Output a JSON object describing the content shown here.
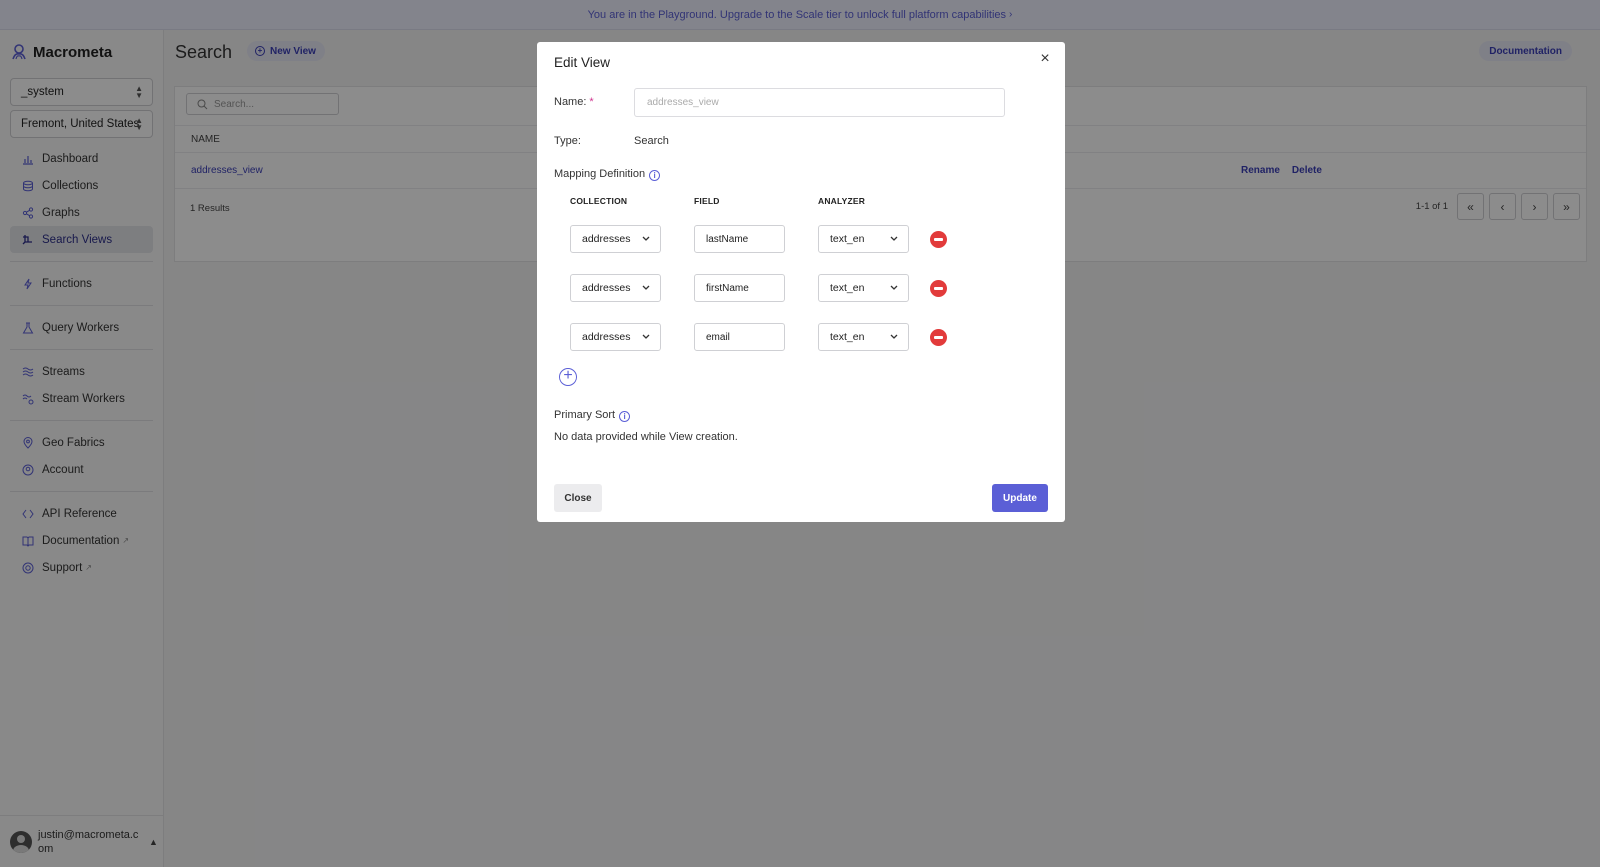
{
  "banner": {
    "text": "You are in the Playground. Upgrade to the Scale tier to unlock full platform capabilities"
  },
  "sidebar": {
    "brand": "Macrometa",
    "database_select": "_system",
    "region_select": "Fremont, United States",
    "items": [
      {
        "label": "Dashboard",
        "icon": "bar-chart-icon"
      },
      {
        "label": "Collections",
        "icon": "database-icon"
      },
      {
        "label": "Graphs",
        "icon": "graph-icon"
      },
      {
        "label": "Search Views",
        "icon": "search-views-icon",
        "active": true
      },
      {
        "label": "Functions",
        "icon": "function-icon"
      },
      {
        "label": "Query Workers",
        "icon": "query-workers-icon"
      },
      {
        "label": "Streams",
        "icon": "streams-icon"
      },
      {
        "label": "Stream Workers",
        "icon": "stream-workers-icon"
      },
      {
        "label": "Geo Fabrics",
        "icon": "geo-pin-icon"
      },
      {
        "label": "Account",
        "icon": "account-icon"
      },
      {
        "label": "API Reference",
        "icon": "code-icon"
      },
      {
        "label": "Documentation",
        "icon": "book-icon"
      },
      {
        "label": "Support",
        "icon": "lifebuoy-icon"
      }
    ],
    "user": "justin@macrometa.com"
  },
  "main": {
    "title": "Search",
    "new_view_label": "New View",
    "documentation_label": "Documentation",
    "search_placeholder": "Search...",
    "table": {
      "columns": [
        "NAME"
      ],
      "rows": [
        {
          "name": "addresses_view",
          "actions": [
            "Rename",
            "Delete"
          ]
        }
      ],
      "results_text": "1 Results",
      "pagination": "1-1 of 1"
    }
  },
  "modal": {
    "title": "Edit View",
    "name_label": "Name:",
    "name_required": "*",
    "name_placeholder": "addresses_view",
    "type_label": "Type:",
    "type_value": "Search",
    "mapping_label": "Mapping Definition",
    "columns": {
      "collection": "COLLECTION",
      "field": "FIELD",
      "analyzer": "ANALYZER"
    },
    "mappings": [
      {
        "collection": "addresses",
        "field": "lastName",
        "analyzer": "text_en"
      },
      {
        "collection": "addresses",
        "field": "firstName",
        "analyzer": "text_en"
      },
      {
        "collection": "addresses",
        "field": "email",
        "analyzer": "text_en"
      }
    ],
    "primary_sort_label": "Primary Sort",
    "primary_sort_text": "No data provided while View creation.",
    "close_label": "Close",
    "update_label": "Update"
  },
  "colors": {
    "accent": "#5b5fd6",
    "danger": "#e23b3b"
  }
}
